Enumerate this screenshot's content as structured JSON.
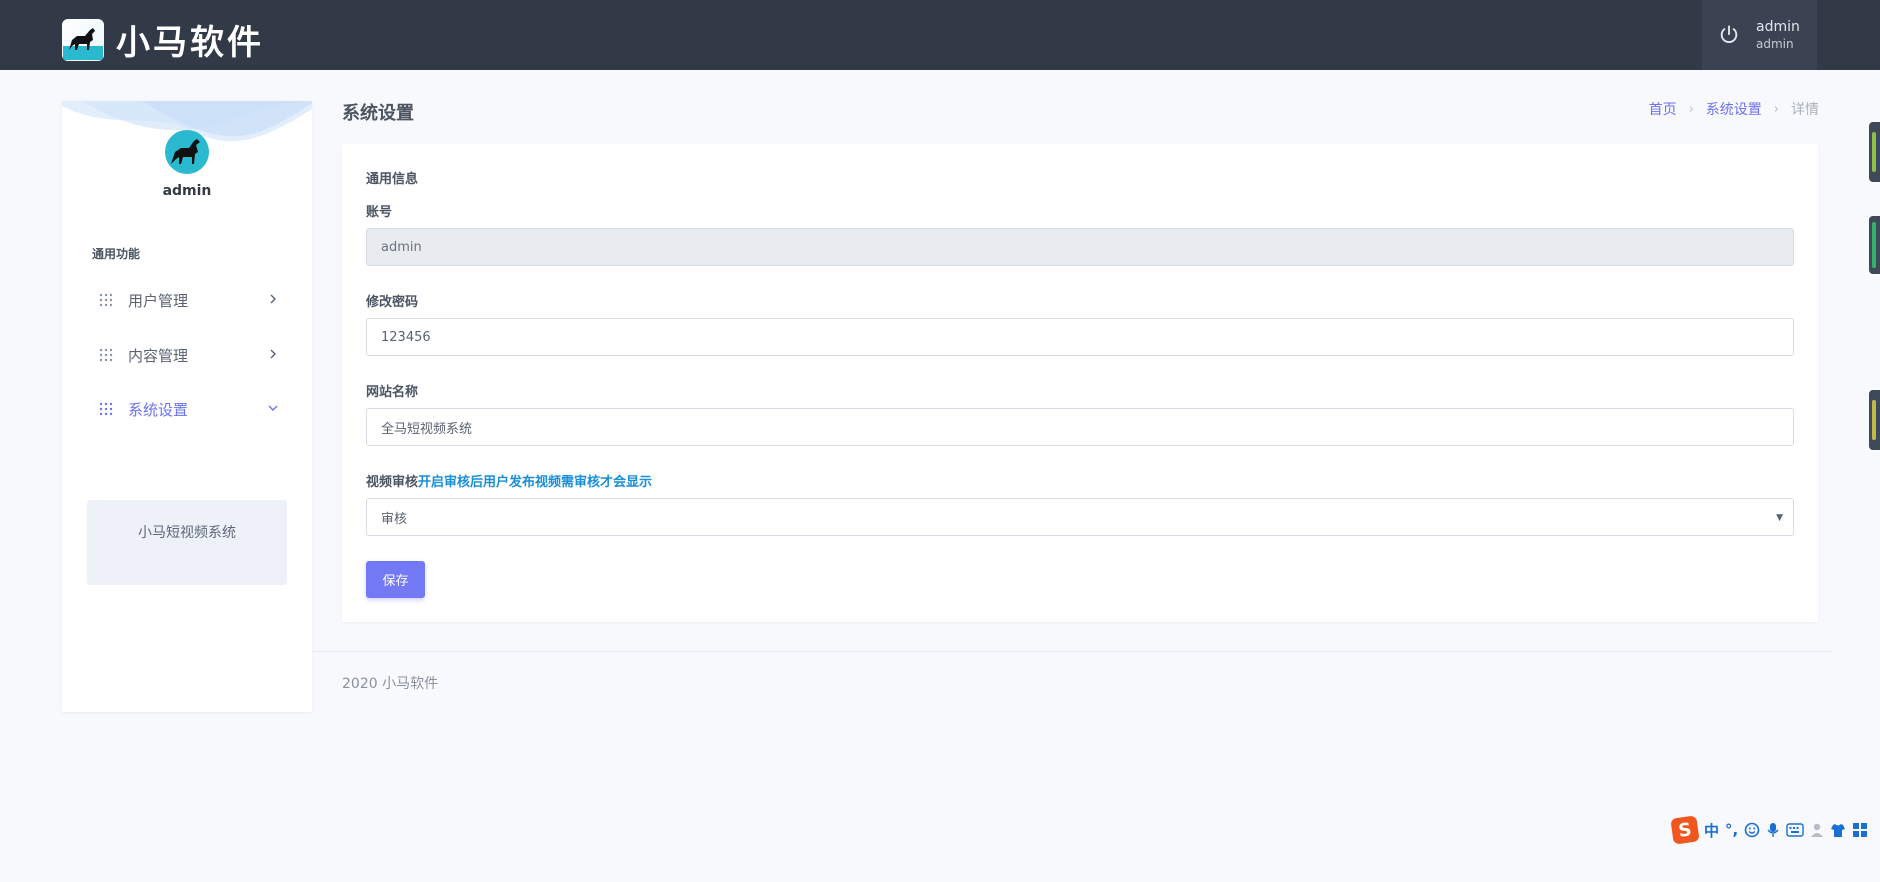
{
  "app": {
    "logo_text": "小马软件"
  },
  "header": {
    "user_name": "admin",
    "user_role": "admin"
  },
  "sidebar": {
    "user_name": "admin",
    "section_title": "通用功能",
    "items": [
      {
        "label": "用户管理",
        "active": false
      },
      {
        "label": "内容管理",
        "active": false
      },
      {
        "label": "系统设置",
        "active": true
      }
    ],
    "card_text": "小马短视频系统"
  },
  "page": {
    "title": "系统设置",
    "breadcrumb": [
      "首页",
      "系统设置",
      "详情"
    ]
  },
  "form": {
    "section_title": "通用信息",
    "account_label": "账号",
    "account_value": "admin",
    "password_label": "修改密码",
    "password_value": "123456",
    "site_name_label": "网站名称",
    "site_name_value": "全马短视频系统",
    "review_label": "视频审核",
    "review_hint": "开启审核后用户发布视频需审核才会显示",
    "review_value": "审核",
    "save_label": "保存"
  },
  "footer": {
    "text": "2020 小马软件"
  },
  "ime": {
    "logo": "S",
    "mode": "中",
    "punct": "°,",
    "icons": [
      "emoji-icon",
      "microphone-icon",
      "keyboard-icon",
      "user-icon",
      "skin-icon",
      "grid-icon"
    ]
  },
  "colors": {
    "topbar": "#323a48",
    "accent": "#6c72f0",
    "save_button": "#7379f4",
    "hint": "#1a8fd6"
  }
}
